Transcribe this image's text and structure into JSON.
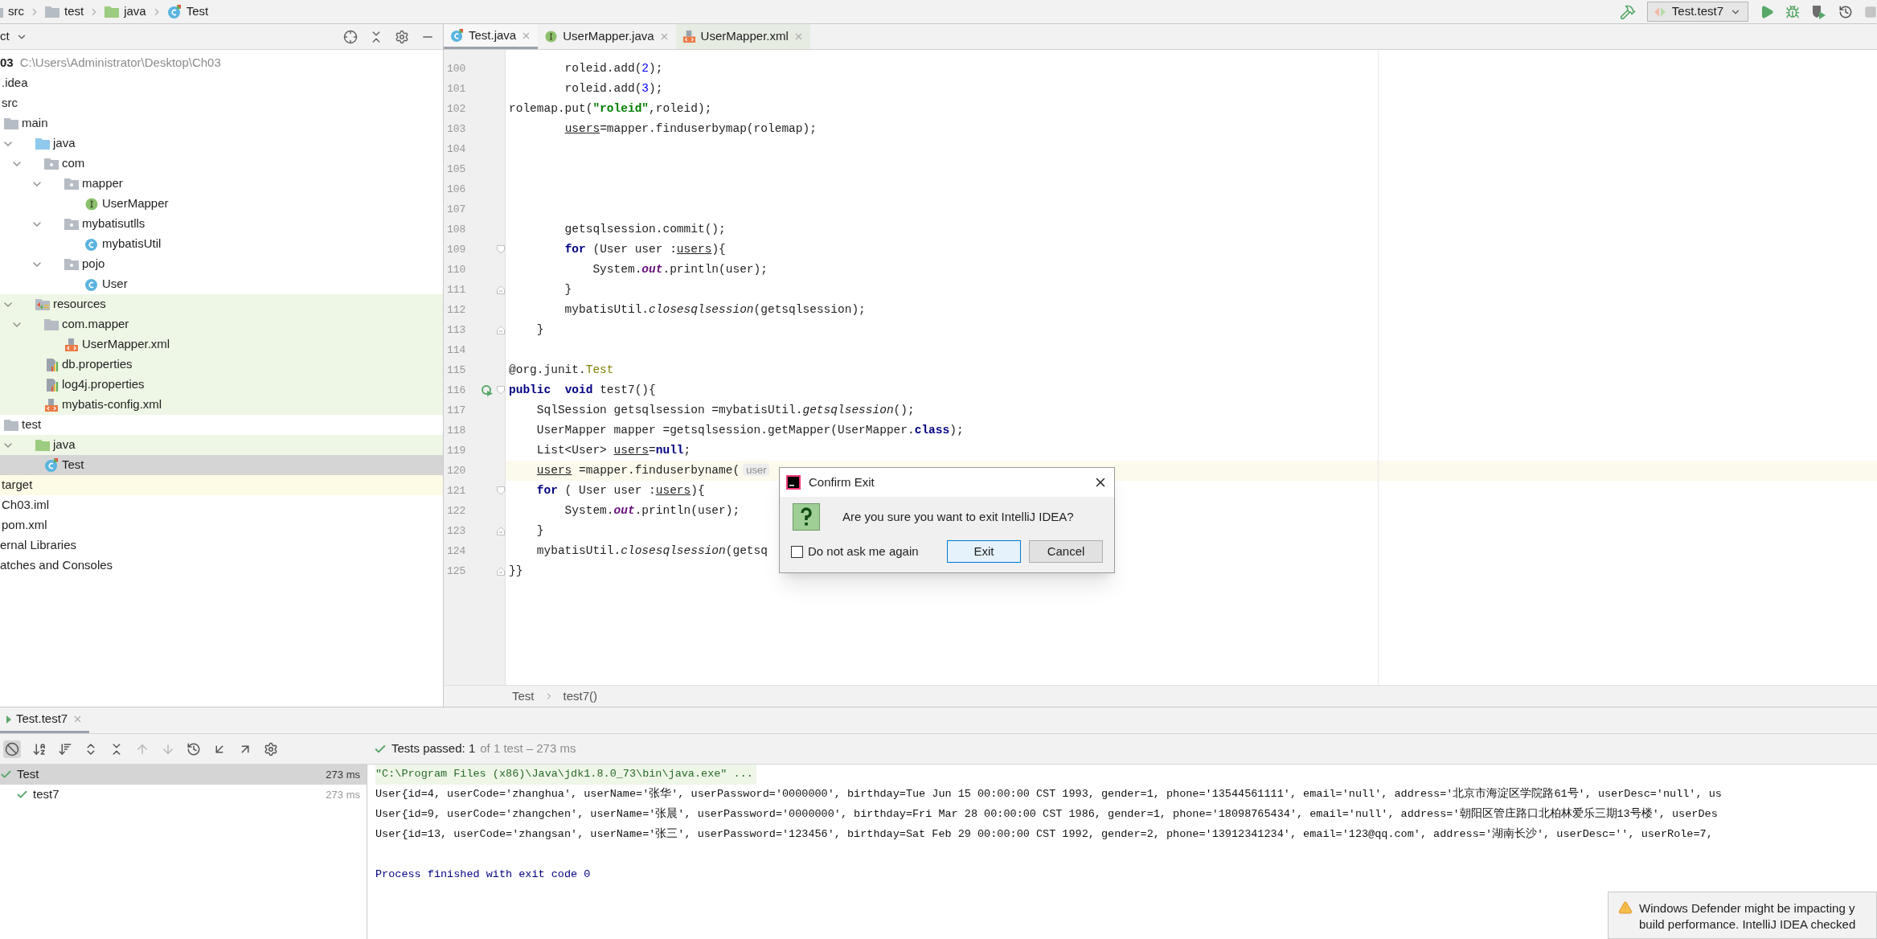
{
  "breadcrumb": [
    {
      "label": "src",
      "kind": "folder"
    },
    {
      "label": "test",
      "kind": "folder"
    },
    {
      "label": "java",
      "kind": "test-folder"
    },
    {
      "label": "Test",
      "kind": "test-class"
    }
  ],
  "run_toolbar": {
    "config": "Test.test7"
  },
  "project": {
    "title": "ct",
    "items": [
      {
        "label": "03",
        "location": "C:\\Users\\Administrator\\Desktop\\Ch03",
        "selected": false,
        "children": [
          {
            "label": ".idea",
            "selected": false
          },
          {
            "label": "src",
            "selected": false,
            "children": [
              {
                "label": "main",
                "kind": "folder",
                "selected": false,
                "children": [
                  {
                    "label": "java",
                    "kind": "source-folder",
                    "expanded": true,
                    "selected": false,
                    "children": [
                      {
                        "label": "com",
                        "kind": "package",
                        "expanded": true,
                        "selected": false,
                        "children": [
                          {
                            "label": "mapper",
                            "kind": "package",
                            "expanded": true,
                            "selected": false,
                            "children": [
                              {
                                "label": "UserMapper",
                                "kind": "interface",
                                "selected": false
                              }
                            ]
                          },
                          {
                            "label": "mybatisutlls",
                            "kind": "package",
                            "expanded": true,
                            "selected": false,
                            "children": [
                              {
                                "label": "mybatisUtil",
                                "kind": "class",
                                "selected": false
                              }
                            ]
                          },
                          {
                            "label": "pojo",
                            "kind": "package",
                            "expanded": true,
                            "selected": false,
                            "children": [
                              {
                                "label": "User",
                                "kind": "class",
                                "selected": false
                              }
                            ]
                          }
                        ]
                      }
                    ]
                  },
                  {
                    "label": "resources",
                    "kind": "resources-folder",
                    "expanded": true,
                    "tinted": true,
                    "selected": false,
                    "children": [
                      {
                        "label": "com.mapper",
                        "kind": "folder",
                        "expanded": true,
                        "tinted": true,
                        "selected": false,
                        "children": [
                          {
                            "label": "UserMapper.xml",
                            "kind": "xml",
                            "tinted": true,
                            "selected": false
                          }
                        ]
                      },
                      {
                        "label": "db.properties",
                        "kind": "properties",
                        "tinted": true,
                        "selected": false
                      },
                      {
                        "label": "log4j.properties",
                        "kind": "properties",
                        "tinted": true,
                        "selected": false
                      },
                      {
                        "label": "mybatis-config.xml",
                        "kind": "xml",
                        "tinted": true,
                        "selected": false
                      }
                    ]
                  }
                ]
              },
              {
                "label": "test",
                "kind": "folder",
                "selected": false,
                "children": [
                  {
                    "label": "java",
                    "kind": "test-folder",
                    "expanded": true,
                    "tinted": true,
                    "selected": false,
                    "children": [
                      {
                        "label": "Test",
                        "kind": "test-class",
                        "selected": true
                      }
                    ]
                  }
                ]
              }
            ]
          },
          {
            "label": "target",
            "excluded": true,
            "selected": false
          },
          {
            "label": "Ch03.iml",
            "selected": false
          },
          {
            "label": "pom.xml",
            "selected": false
          }
        ]
      },
      {
        "label": "ernal Libraries",
        "selected": false
      },
      {
        "label": "atches and Consoles",
        "selected": false
      }
    ]
  },
  "editor": {
    "tabs": [
      {
        "label": "Test.java",
        "kind": "test-class",
        "selected": true
      },
      {
        "label": "UserMapper.java",
        "kind": "interface",
        "selected": false
      },
      {
        "label": "UserMapper.xml",
        "kind": "xml",
        "selected": false
      }
    ],
    "lines": [
      {
        "number": "100",
        "current": false,
        "tokens": [
          {
            "kind": "plain",
            "text": "        roleid.add("
          },
          {
            "kind": "number",
            "text": "2"
          },
          {
            "kind": "plain",
            "text": ");"
          }
        ]
      },
      {
        "number": "101",
        "current": false,
        "tokens": [
          {
            "kind": "plain",
            "text": "        roleid.add("
          },
          {
            "kind": "number",
            "text": "3"
          },
          {
            "kind": "plain",
            "text": ");"
          }
        ]
      },
      {
        "number": "102",
        "current": false,
        "tokens": [
          {
            "kind": "plain",
            "text": "rolemap.put("
          },
          {
            "kind": "string",
            "text": "\"roleid\""
          },
          {
            "kind": "plain",
            "text": ",roleid);"
          }
        ]
      },
      {
        "number": "103",
        "current": false,
        "tokens": [
          {
            "kind": "reassigned",
            "text": "        users"
          },
          {
            "kind": "plain",
            "text": "=mapper.finduserbymap(rolemap);"
          }
        ]
      },
      {
        "number": "104",
        "current": false
      },
      {
        "number": "105",
        "current": false
      },
      {
        "number": "106",
        "current": false
      },
      {
        "number": "107",
        "current": false
      },
      {
        "number": "108",
        "current": false,
        "tokens": [
          {
            "kind": "plain",
            "text": "        getsqlsession.commit();"
          }
        ]
      },
      {
        "number": "109",
        "current": false,
        "kind": "block-start",
        "tokens": [
          {
            "kind": "keyword",
            "text": "        for"
          },
          {
            "kind": "plain",
            "text": " (User user :"
          },
          {
            "kind": "reassigned",
            "text": "users"
          },
          {
            "kind": "plain",
            "text": "){"
          }
        ]
      },
      {
        "number": "110",
        "current": false,
        "tokens": [
          {
            "kind": "plain",
            "text": "            System."
          },
          {
            "kind": "field",
            "text": "out"
          },
          {
            "kind": "plain",
            "text": ".println(user);"
          }
        ]
      },
      {
        "number": "111",
        "current": false,
        "kind": "block-end",
        "tokens": [
          {
            "kind": "plain",
            "text": "        }"
          }
        ]
      },
      {
        "number": "112",
        "current": false,
        "tokens": [
          {
            "kind": "plain",
            "text": "        mybatisUtil."
          },
          {
            "kind": "static",
            "text": "closesqlsession"
          },
          {
            "kind": "plain",
            "text": "(getsqlsession);"
          }
        ]
      },
      {
        "number": "113",
        "current": false,
        "kind": "block-end",
        "tokens": [
          {
            "kind": "plain",
            "text": "    }"
          }
        ]
      },
      {
        "number": "114",
        "current": false
      },
      {
        "number": "115",
        "current": false,
        "tokens": [
          {
            "kind": "plain",
            "text": "@org.junit."
          },
          {
            "kind": "annotation",
            "text": "Test"
          }
        ]
      },
      {
        "number": "116",
        "current": false,
        "kind": "test-method",
        "tokens": [
          {
            "kind": "keyword",
            "text": "public"
          },
          {
            "kind": "keyword",
            "text": "  void"
          },
          {
            "kind": "plain",
            "text": " test7(){"
          }
        ]
      },
      {
        "number": "117",
        "current": false,
        "tokens": [
          {
            "kind": "plain",
            "text": "    SqlSession getsqlsession =mybatisUtil."
          },
          {
            "kind": "static",
            "text": "getsqlsession"
          },
          {
            "kind": "plain",
            "text": "();"
          }
        ]
      },
      {
        "number": "118",
        "current": false,
        "tokens": [
          {
            "kind": "plain",
            "text": "    UserMapper mapper =getsqlsession.getMapper(UserMapper."
          },
          {
            "kind": "keyword",
            "text": "class"
          },
          {
            "kind": "plain",
            "text": ");"
          }
        ]
      },
      {
        "number": "119",
        "current": false,
        "tokens": [
          {
            "kind": "plain",
            "text": "    List<User> "
          },
          {
            "kind": "reassigned",
            "text": "users"
          },
          {
            "kind": "plain",
            "text": "="
          },
          {
            "kind": "keyword",
            "text": "null"
          },
          {
            "kind": "plain",
            "text": ";"
          }
        ]
      },
      {
        "number": "120",
        "current": true,
        "tokens": [
          {
            "kind": "reassigned",
            "text": "    users"
          },
          {
            "kind": "plain",
            "text": " =mapper.finduserbyname("
          },
          {
            "kind": "hint",
            "text": "user"
          }
        ]
      },
      {
        "number": "121",
        "current": false,
        "kind": "block-start",
        "tokens": [
          {
            "kind": "keyword",
            "text": "    for"
          },
          {
            "kind": "plain",
            "text": " ( User user :"
          },
          {
            "kind": "reassigned",
            "text": "users"
          },
          {
            "kind": "plain",
            "text": "){"
          }
        ]
      },
      {
        "number": "122",
        "current": false,
        "tokens": [
          {
            "kind": "plain",
            "text": "        System."
          },
          {
            "kind": "field",
            "text": "out"
          },
          {
            "kind": "plain",
            "text": ".println(user);"
          }
        ]
      },
      {
        "number": "123",
        "current": false,
        "kind": "block-end",
        "tokens": [
          {
            "kind": "plain",
            "text": "    }"
          }
        ]
      },
      {
        "number": "124",
        "current": false,
        "tokens": [
          {
            "kind": "plain",
            "text": "    mybatisUtil."
          },
          {
            "kind": "static",
            "text": "closesqlsession"
          },
          {
            "kind": "plain",
            "text": "(getsq"
          }
        ]
      },
      {
        "number": "125",
        "current": false,
        "kind": "block-end",
        "tokens": [
          {
            "kind": "plain",
            "text": "}}"
          }
        ]
      }
    ],
    "breadcrumb": [
      "Test",
      "test7()"
    ]
  },
  "dialog": {
    "title": "Confirm Exit",
    "message": "Are you sure you want to exit IntelliJ IDEA?",
    "checkbox": {
      "label": "Do not ask me again",
      "checked": false
    },
    "buttons": [
      {
        "label": "Exit",
        "default": true
      },
      {
        "label": "Cancel",
        "default": false
      }
    ]
  },
  "run_panel": {
    "tab": "Test.test7",
    "status": {
      "label": "Tests passed: 1",
      "detail": "of 1 test – 273 ms"
    },
    "tests": [
      {
        "name": "Test",
        "time": "273 ms",
        "selected": true,
        "children": [
          {
            "name": "test7",
            "time": "273 ms",
            "selected": false
          }
        ]
      }
    ],
    "console": [
      {
        "kind": "command",
        "text": "\"C:\\Program Files (x86)\\Java\\jdk1.8.0_73\\bin\\java.exe\" ..."
      },
      {
        "kind": "output",
        "text": "User{id=4, userCode='zhanghua', userName='张华', userPassword='0000000', birthday=Tue Jun 15 00:00:00 CST 1993, gender=1, phone='13544561111', email='null', address='北京市海淀区学院路61号', userDesc='null', us"
      },
      {
        "kind": "output",
        "text": "User{id=9, userCode='zhangchen', userName='张晨', userPassword='0000000', birthday=Fri Mar 28 00:00:00 CST 1986, gender=1, phone='18098765434', email='null', address='朝阳区管庄路口北柏林爱乐三期13号楼', userDes"
      },
      {
        "kind": "output",
        "text": "User{id=13, userCode='zhangsan', userName='张三', userPassword='123456', birthday=Sat Feb 29 00:00:00 CST 1992, gender=2, phone='13912341234', email='123@qq.com', address='湖南长沙', userDesc='', userRole=7,"
      },
      {
        "kind": "exit",
        "text": "Process finished with exit code 0"
      }
    ]
  },
  "notification": {
    "lines": [
      "Windows Defender might be impacting y",
      "build performance. IntelliJ IDEA checked"
    ]
  }
}
